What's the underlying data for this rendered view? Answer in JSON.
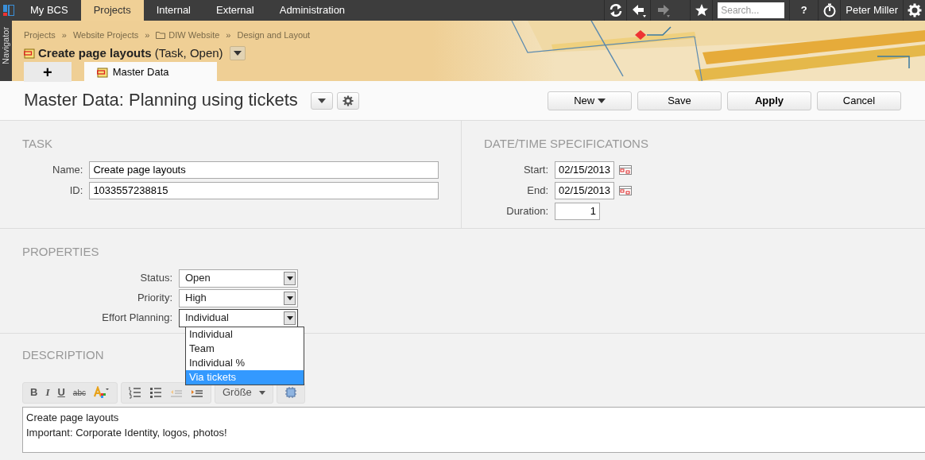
{
  "top_nav": {
    "tabs": [
      {
        "label": "My BCS",
        "selected": false
      },
      {
        "label": "Projects",
        "selected": true
      },
      {
        "label": "Internal",
        "selected": false
      },
      {
        "label": "External",
        "selected": false
      },
      {
        "label": "Administration",
        "selected": false
      }
    ],
    "history": [
      {
        "kind": "back",
        "disabled": false
      },
      {
        "kind": "forward",
        "disabled": true
      }
    ],
    "search": {
      "placeholder": "Search..."
    },
    "help": "?",
    "user": "Peter Miller"
  },
  "navigator": "Navigator",
  "breadcrumb": {
    "separator": "»",
    "items": [
      {
        "label": "Projects",
        "folder": false
      },
      {
        "label": "Website Projects",
        "folder": false
      },
      {
        "label": "DIW Website",
        "folder": true
      },
      {
        "label": "Design and Layout",
        "folder": false
      }
    ]
  },
  "object": {
    "title": "Create page layouts",
    "subtitle": "(Task, Open)"
  },
  "tabs": [
    {
      "label": "+",
      "selected": false
    },
    {
      "label": "Master Data",
      "selected": true
    }
  ],
  "page_title": "Master Data: Planning using tickets",
  "actions": [
    {
      "label": "New",
      "kind": "menu"
    },
    {
      "label": "Save",
      "kind": "default"
    },
    {
      "label": "Apply",
      "kind": "primary"
    },
    {
      "label": "Cancel",
      "kind": "default"
    }
  ],
  "task": {
    "heading": "TASK",
    "fields": [
      {
        "label": "Name:",
        "value": "Create page layouts"
      },
      {
        "label": "ID:",
        "value": "1033557238815"
      }
    ]
  },
  "dates": {
    "heading": "DATE/TIME SPECIFICATIONS",
    "fields": [
      {
        "label": "Start:",
        "value": "02/15/2013",
        "kind": "date"
      },
      {
        "label": "End:",
        "value": "02/15/2013",
        "kind": "date"
      },
      {
        "label": "Duration:",
        "value": "1",
        "kind": "number"
      }
    ]
  },
  "properties": {
    "heading": "PROPERTIES",
    "fields": [
      {
        "label": "Status:",
        "value": "Open",
        "expanded": false
      },
      {
        "label": "Priority:",
        "value": "High",
        "expanded": false
      },
      {
        "label": "Effort Planning:",
        "value": "Individual",
        "expanded": true
      }
    ],
    "options": [
      {
        "label": "Individual",
        "selected": false
      },
      {
        "label": "Team",
        "selected": false
      },
      {
        "label": "Individual %",
        "selected": false
      },
      {
        "label": "Via tickets",
        "selected": true
      }
    ]
  },
  "description": {
    "heading": "DESCRIPTION",
    "toolbar": [
      {
        "kind": "bold",
        "label": "B"
      },
      {
        "kind": "italic",
        "label": "I"
      },
      {
        "kind": "underline",
        "label": "U"
      },
      {
        "kind": "strike",
        "label": "abc"
      },
      {
        "kind": "color"
      },
      {
        "kind": "sep"
      },
      {
        "kind": "olist"
      },
      {
        "kind": "ulist"
      },
      {
        "kind": "outdent"
      },
      {
        "kind": "indent"
      },
      {
        "kind": "sep"
      },
      {
        "kind": "size",
        "label": "Größe"
      },
      {
        "kind": "sep"
      },
      {
        "kind": "source"
      }
    ],
    "lines": [
      "Create page layouts",
      "Important: Corporate Identity, logos, photos!"
    ]
  }
}
